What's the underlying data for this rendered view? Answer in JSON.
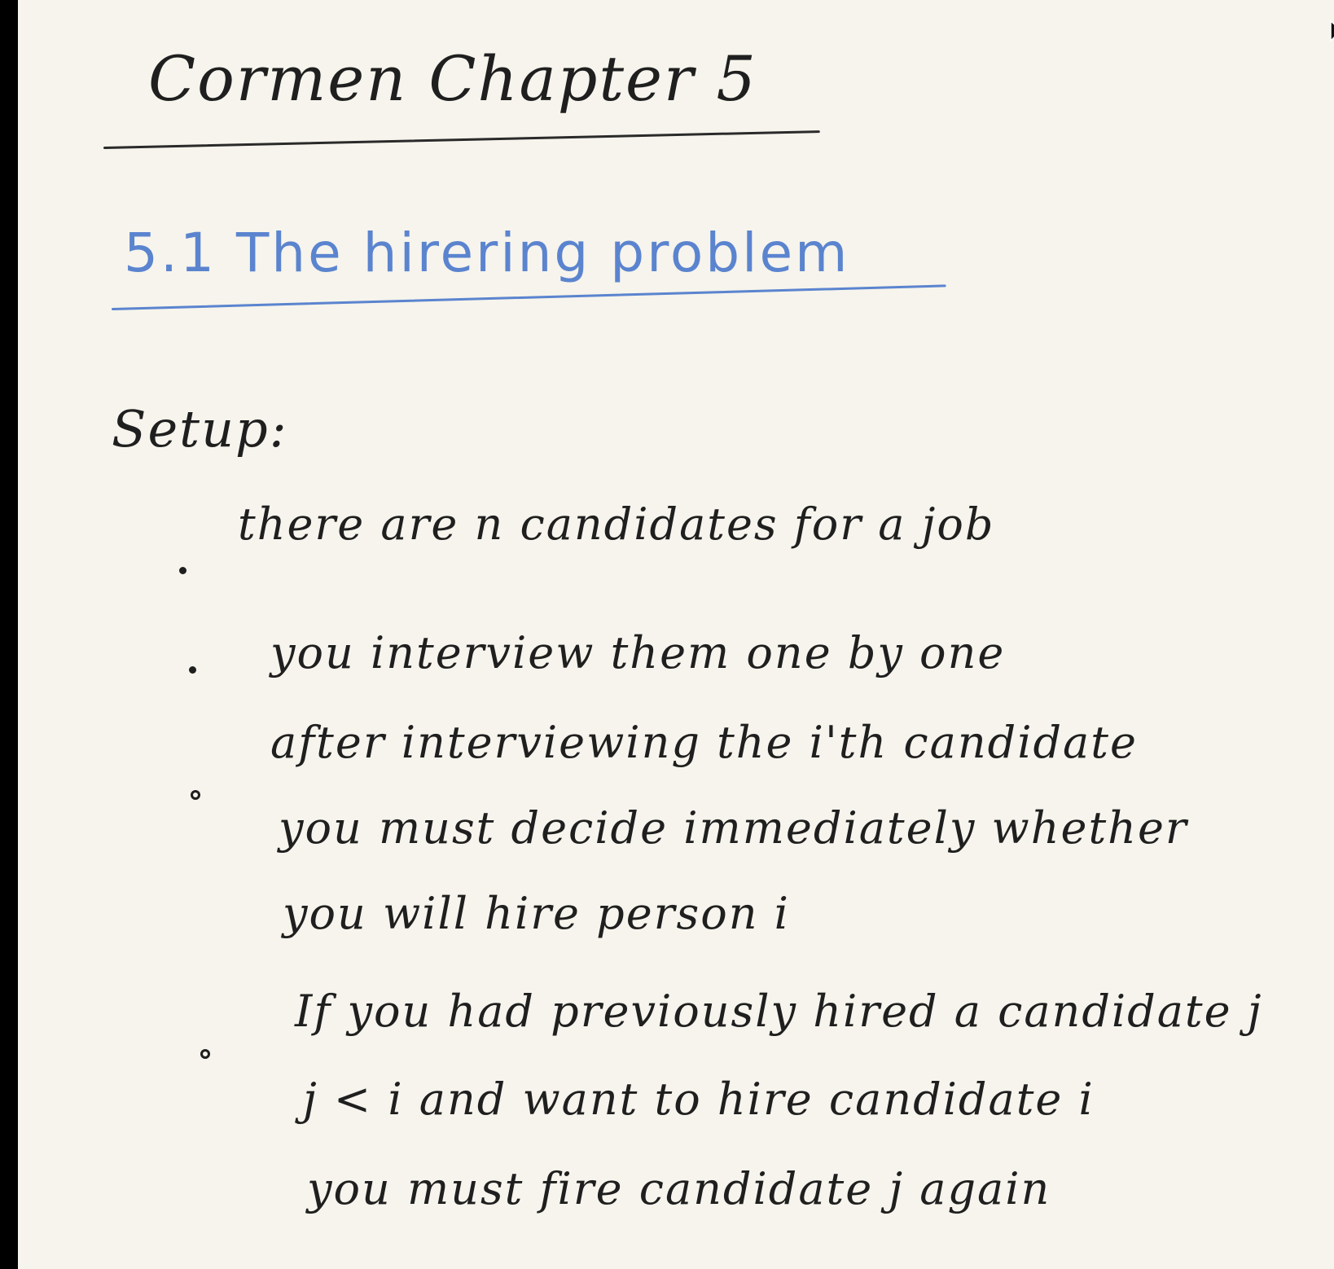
{
  "heading": "Cormen Chapter 5",
  "section": "5.1 The hirering problem",
  "setup_label": "Setup:",
  "bullets": [
    {
      "lines": [
        "there are n candidates for a job"
      ]
    },
    {
      "lines": [
        "you interview them one by one"
      ]
    },
    {
      "lines": [
        "after interviewing the i'th candidate",
        "you must decide immediately whether",
        "you will hire person i"
      ]
    },
    {
      "lines": [
        "If you had previously hired a candidate j",
        "j < i and want to hire candidate i",
        "you must fire candidate j again"
      ]
    }
  ],
  "colors": {
    "ink": "#1f1f1f",
    "section_blue": "#5b84cf",
    "paper": "#f6f4ec"
  },
  "icons": [
    "mouse-pointer-icon"
  ]
}
